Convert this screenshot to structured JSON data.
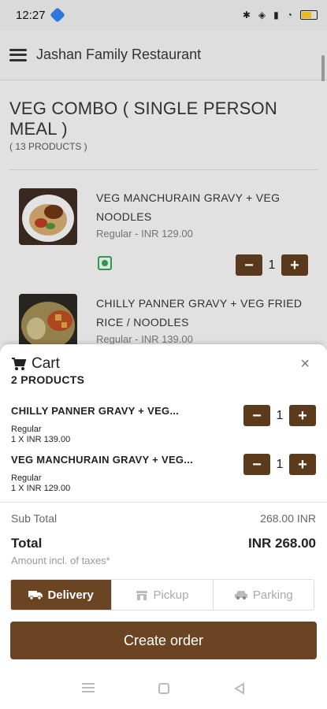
{
  "status_bar": {
    "time": "12:27",
    "battery_color": "#f3c11b"
  },
  "appbar": {
    "title": "Jashan Family Restaurant",
    "menu_icon": "hamburger-menu-icon"
  },
  "combo": {
    "title": "VEG COMBO ( SINGLE PERSON MEAL )",
    "count": "( 13 PRODUCTS )"
  },
  "products": [
    {
      "name": "VEG MANCHURAIN GRAVY + VEG NOODLES",
      "price": "Regular - INR 129.00",
      "qty": "1",
      "veg_icon": "veg-indicator-icon"
    },
    {
      "name": "CHILLY PANNER GRAVY + VEG FRIED RICE / NOODLES",
      "price": "Regular - INR 139.00"
    }
  ],
  "cart": {
    "title": "Cart",
    "count": "2 PRODUCTS",
    "close_label": "×",
    "items": [
      {
        "name": "CHILLY PANNER GRAVY + VEG...",
        "variant": "Regular",
        "price": "1 X INR 139.00",
        "qty": "1"
      },
      {
        "name": "VEG MANCHURAIN GRAVY + VEG...",
        "variant": "Regular",
        "price": "1 X INR 129.00",
        "qty": "1"
      }
    ],
    "subtotal_label": "Sub Total",
    "subtotal_value": "268.00 INR",
    "total_label": "Total",
    "total_value": "INR 268.00",
    "tax_note": "Amount incl. of taxes*",
    "tabs": [
      {
        "label": "Delivery",
        "icon": "truck-icon",
        "active": true
      },
      {
        "label": "Pickup",
        "icon": "store-icon",
        "active": false
      },
      {
        "label": "Parking",
        "icon": "car-icon",
        "active": false
      }
    ],
    "create_order_label": "Create order"
  },
  "colors": {
    "brand": "#6b4423",
    "stepper": "#5c3a1c",
    "veg_green": "#2e9e4f"
  }
}
